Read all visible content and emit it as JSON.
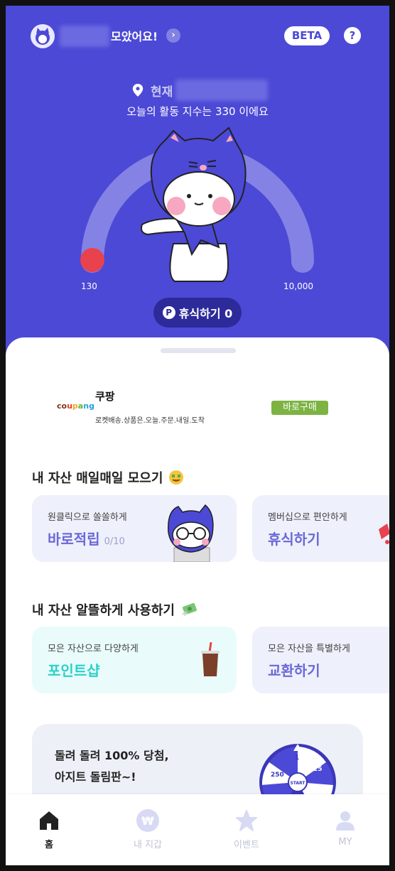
{
  "header": {
    "collect_text": "모았어요!",
    "beta_label": "BETA",
    "help_label": "?"
  },
  "location": {
    "label": "현재"
  },
  "activity_text": "오늘의 활동 지수는 330 이에요",
  "gauge": {
    "min_label": "130",
    "max_label": "10,000",
    "value": 130,
    "max": 10000
  },
  "rest_pill": {
    "badge": "P",
    "label": "휴식하기 0"
  },
  "ad": {
    "logo": "coupang",
    "title": "쿠팡",
    "description": "로켓배송.상품은.오늘.주문.내일.도착",
    "button": "바로구매"
  },
  "section_collect": {
    "title": "내 자산 매일매일 모으기",
    "cards": [
      {
        "sub": "원클릭으로 쏠쏠하게",
        "main": "바로적립",
        "count": "0/10"
      },
      {
        "sub": "멤버십으로 편안하게",
        "main": "휴식하기"
      }
    ]
  },
  "section_use": {
    "title": "내 자산 알뜰하게 사용하기",
    "cards": [
      {
        "sub": "모은 자산으로 다양하게",
        "main": "포인트샵"
      },
      {
        "sub": "모은 자산을 특별하게",
        "main": "교환하기"
      }
    ]
  },
  "roulette": {
    "line1": "돌려 돌려 100% 당첨,",
    "line2": "아지트 돌림판~!",
    "start": "START",
    "segments": [
      "1",
      "25",
      "250"
    ]
  },
  "bottom_nav": [
    {
      "label": "홈",
      "active": true
    },
    {
      "label": "내 지갑",
      "active": false
    },
    {
      "label": "이벤트",
      "active": false
    },
    {
      "label": "MY",
      "active": false
    }
  ],
  "colors": {
    "primary": "#4c49d6",
    "dark_pill": "#2d2a9a",
    "gauge_red": "#e8424f",
    "mint": "#2ad0c9",
    "card_lav": "#eef0fb"
  }
}
